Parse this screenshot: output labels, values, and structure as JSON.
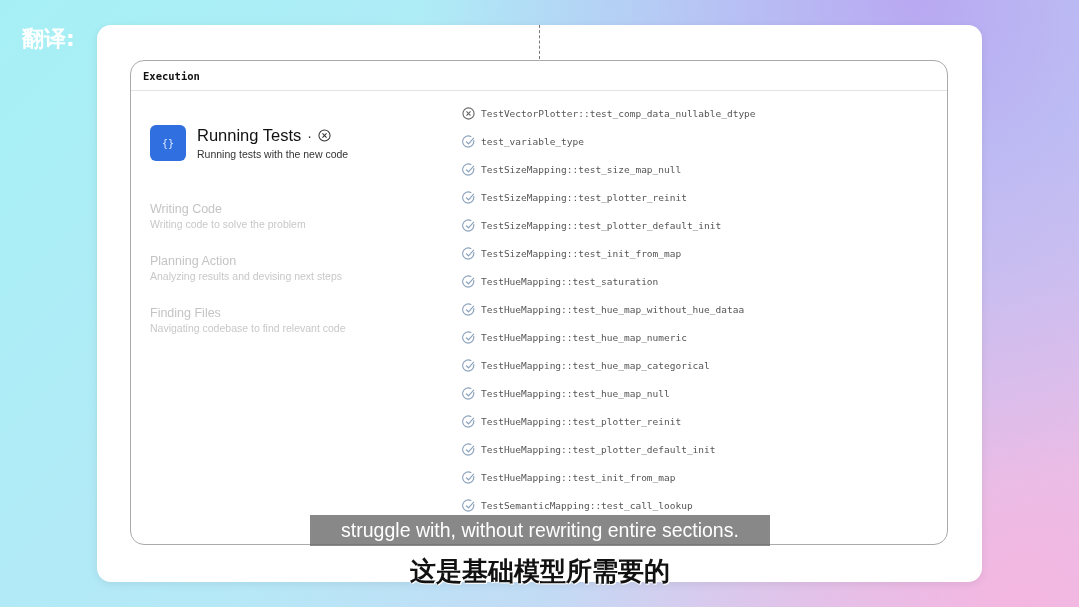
{
  "credit": "翻译:",
  "panel": {
    "title": "Execution"
  },
  "current_step": {
    "icon_text": "{}",
    "title": "Running Tests",
    "separator": "·",
    "subtitle": "Running tests with the new code"
  },
  "steps": [
    {
      "title": "Writing Code",
      "subtitle": "Writing code to solve the problem"
    },
    {
      "title": "Planning Action",
      "subtitle": "Analyzing results and devising next steps"
    },
    {
      "title": "Finding Files",
      "subtitle": "Navigating codebase to find relevant code"
    }
  ],
  "tests": [
    {
      "name": "TestVectorPlotter::test_comp_data_nullable_dtype",
      "kind": "failed"
    },
    {
      "name": "test_variable_type",
      "kind": "passed"
    },
    {
      "name": "TestSizeMapping::test_size_map_null",
      "kind": "passed"
    },
    {
      "name": "TestSizeMapping::test_plotter_reinit",
      "kind": "passed"
    },
    {
      "name": "TestSizeMapping::test_plotter_default_init",
      "kind": "passed"
    },
    {
      "name": "TestSizeMapping::test_init_from_map",
      "kind": "passed"
    },
    {
      "name": "TestHueMapping::test_saturation",
      "kind": "passed"
    },
    {
      "name": "TestHueMapping::test_hue_map_without_hue_dataa",
      "kind": "passed"
    },
    {
      "name": "TestHueMapping::test_hue_map_numeric",
      "kind": "passed"
    },
    {
      "name": "TestHueMapping::test_hue_map_categorical",
      "kind": "passed"
    },
    {
      "name": "TestHueMapping::test_hue_map_null",
      "kind": "passed"
    },
    {
      "name": "TestHueMapping::test_plotter_reinit",
      "kind": "passed"
    },
    {
      "name": "TestHueMapping::test_plotter_default_init",
      "kind": "passed"
    },
    {
      "name": "TestHueMapping::test_init_from_map",
      "kind": "passed"
    },
    {
      "name": "TestSemanticMapping::test_call_lookup",
      "kind": "passed"
    }
  ],
  "subtitles": {
    "english": "struggle with, without rewriting entire sections.",
    "chinese": "这是基础模型所需要的"
  }
}
